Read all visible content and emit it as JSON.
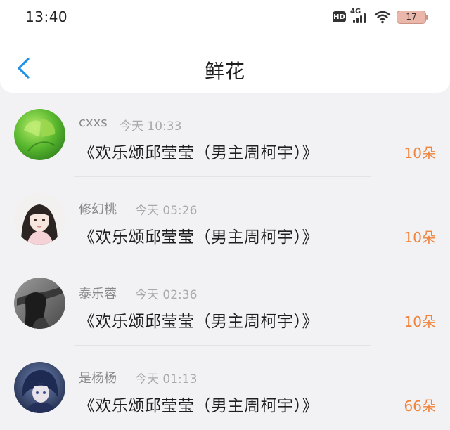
{
  "status_bar": {
    "time": "13:40",
    "hd_label": "HD",
    "network_label": "4G",
    "battery": "17"
  },
  "header": {
    "title": "鲜花",
    "back_icon": "chevron-left-icon",
    "accent_color": "#1e90e6"
  },
  "flowers": [
    {
      "user": "cxxs",
      "time": "今天 10:33",
      "book": "《欢乐颂邱莹莹（男主周柯宇）》",
      "count": "10朵"
    },
    {
      "user": "修幻桃",
      "time": "今天 05:26",
      "book": "《欢乐颂邱莹莹（男主周柯宇）》",
      "count": "10朵"
    },
    {
      "user": "泰乐蓉",
      "time": "今天 02:36",
      "book": "《欢乐颂邱莹莹（男主周柯宇）》",
      "count": "10朵"
    },
    {
      "user": "是杨杨",
      "time": "今天 01:13",
      "book": "《欢乐颂邱莹莹（男主周柯宇）》",
      "count": "66朵"
    }
  ],
  "colors": {
    "count": "#f0843c",
    "username": "#8a8a8a",
    "time": "#a9a9a9"
  }
}
